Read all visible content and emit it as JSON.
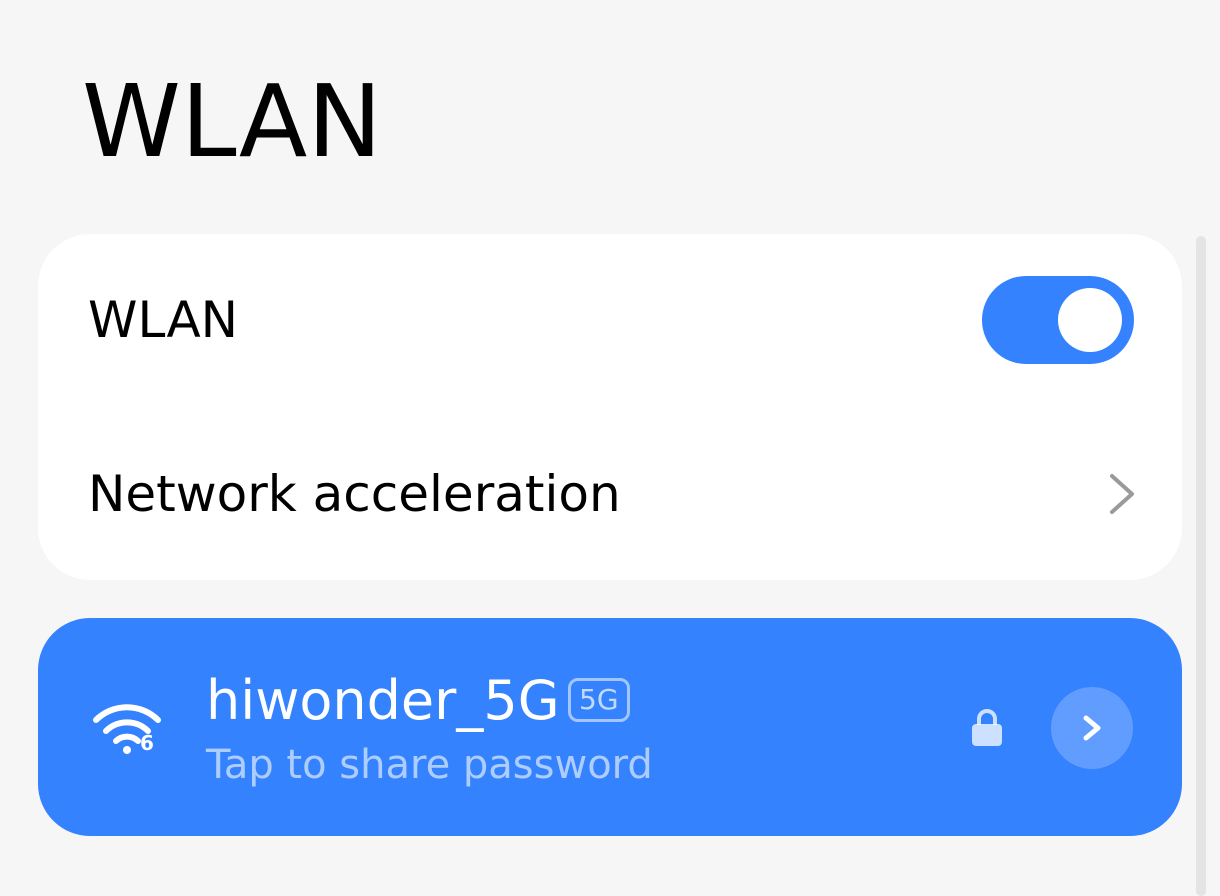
{
  "page": {
    "title": "WLAN"
  },
  "settings": {
    "wlan_label": "WLAN",
    "wlan_enabled": true,
    "network_acceleration_label": "Network acceleration"
  },
  "connected_network": {
    "ssid": "hiwonder_5G",
    "band": "5G",
    "wifi_generation": "6",
    "subtitle": "Tap to share password",
    "secured": true
  },
  "colors": {
    "accent": "#3482fe",
    "background": "#f6f6f6",
    "card": "#ffffff"
  },
  "icons": {
    "wifi": "wifi-6-icon",
    "lock": "lock-icon",
    "chevron": "chevron-right-icon"
  }
}
